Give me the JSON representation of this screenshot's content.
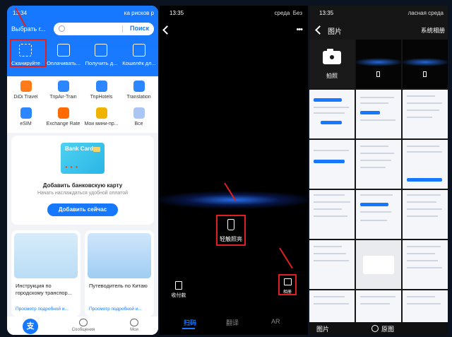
{
  "panel1": {
    "status_time": "13:34",
    "status_right": "ка рисков р",
    "city": "Выбрать г...",
    "search_button": "Поиск",
    "quick_actions": [
      {
        "label": "Сканируйте",
        "icon": "scan-icon"
      },
      {
        "label": "Оплачивать...",
        "icon": "barcode-icon"
      },
      {
        "label": "Получить д...",
        "icon": "receive-money-icon"
      },
      {
        "label": "Кошелёк дл...",
        "icon": "wallet-icon"
      }
    ],
    "services": [
      {
        "label": "DiDi Travel",
        "icon": "didi-icon",
        "color": "#ff7a1a"
      },
      {
        "label": "TripAir-Train",
        "icon": "plane-icon",
        "color": "#1677ff"
      },
      {
        "label": "TripHotels",
        "icon": "hotel-icon",
        "color": "#1677ff"
      },
      {
        "label": "Translation",
        "icon": "translate-icon",
        "color": "#1677ff"
      },
      {
        "label": "eSIM",
        "icon": "sim-icon",
        "color": "#1677ff"
      },
      {
        "label": "Exchange Rate",
        "icon": "yuan-icon",
        "color": "#ff6b00"
      },
      {
        "label": "Мои мини-пр...",
        "icon": "mini-programs-icon",
        "color": "#1677ff"
      },
      {
        "label": "Все",
        "icon": "all-apps-icon",
        "color": "#1677ff"
      }
    ],
    "bank_card": {
      "card_text": "Bank Card",
      "title": "Добавить банковскую карту",
      "subtitle": "Начать наслаждаться удобной оплатой",
      "button": "Добавить сейчас"
    },
    "promos": [
      {
        "title": "Инструкция по городскому транспор...",
        "link": "Просмотр подробной и..."
      },
      {
        "title": "Путеводитель по Китаю",
        "link": "Просмотр подробной и..."
      }
    ],
    "tabbar": [
      {
        "label": "Сообщения",
        "icon": "chat-icon"
      },
      {
        "label": "Мои",
        "icon": "profile-icon"
      }
    ],
    "home_logo": "支"
  },
  "panel2": {
    "status_time": "13:35",
    "status_right": "среда",
    "status_right2": "Без",
    "torch_label": "轻触照亮",
    "pay_code_label": "收付款",
    "album_label": "相册",
    "modes": [
      "扫码",
      "翻译",
      "AR"
    ]
  },
  "panel3": {
    "status_time": "13:35",
    "status_right": "ласная среда",
    "title": "图片",
    "system_album": "系统相册",
    "camera_label": "拍照",
    "bottom_left": "图片",
    "bottom_original": "原图"
  },
  "colors": {
    "brand_blue": "#1677ff",
    "highlight_red": "#e02020"
  }
}
